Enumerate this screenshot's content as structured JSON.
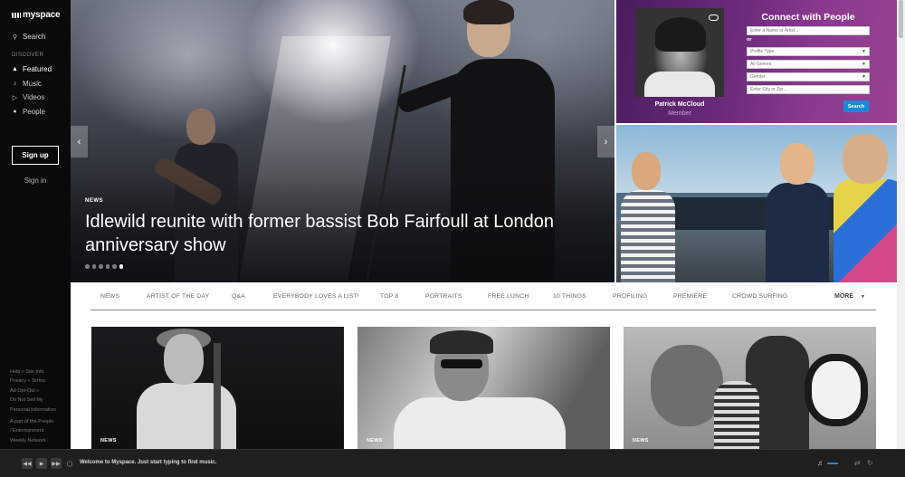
{
  "brand": {
    "logo_text": "myspace"
  },
  "sidebar": {
    "search_label": "Search",
    "discover_heading": "DISCOVER",
    "items": [
      {
        "label": "Featured",
        "icon": "flame-icon",
        "active": true
      },
      {
        "label": "Music",
        "icon": "music-note-icon"
      },
      {
        "label": "Videos",
        "icon": "video-icon"
      },
      {
        "label": "People",
        "icon": "people-icon"
      }
    ],
    "signup_label": "Sign up",
    "signin_label": "Sign in",
    "footer_links": [
      "Help » Site Info",
      "Privacy » Terms",
      "Ad Opt-Out »",
      "Do Not Sell My",
      "Personal Information",
      "A part of the People",
      "/ Entertainment",
      "Weekly Network"
    ]
  },
  "hero": {
    "tag": "NEWS",
    "title": "Idlewild reunite with former bassist Bob Fairfoull at London anniversary show",
    "slide_count": 6,
    "active_slide": 6
  },
  "connect": {
    "title": "Connect with People",
    "member_name": "Patrick McCloud",
    "member_role": "Member",
    "name_placeholder": "Enter a Name or Artist...",
    "or_label": "or",
    "profile_type": "Profile Type",
    "genres": "All Genres",
    "gender": "Gender",
    "location_placeholder": "Enter City or Zip...",
    "search_label": "Search"
  },
  "categories": [
    "NEWS",
    "ARTIST OF THE DAY",
    "Q&A",
    "EVERYBODY LOVES A LIST!",
    "TOP 8",
    "PORTRAITS",
    "FREE LUNCH",
    "10 THINGS",
    "PROFILING",
    "PREMIERE",
    "CROWD SURFING"
  ],
  "more_label": "MORE",
  "cards": [
    {
      "tag": "NEWS"
    },
    {
      "tag": "NEWS"
    },
    {
      "tag": "NEWS"
    }
  ],
  "player": {
    "message": "Welcome to Myspace. Just start typing to find music."
  },
  "colors": {
    "sidebar_bg": "#0a0a0a",
    "accent_blue": "#1a88d8",
    "connect_purple": "#6a2a7a"
  }
}
